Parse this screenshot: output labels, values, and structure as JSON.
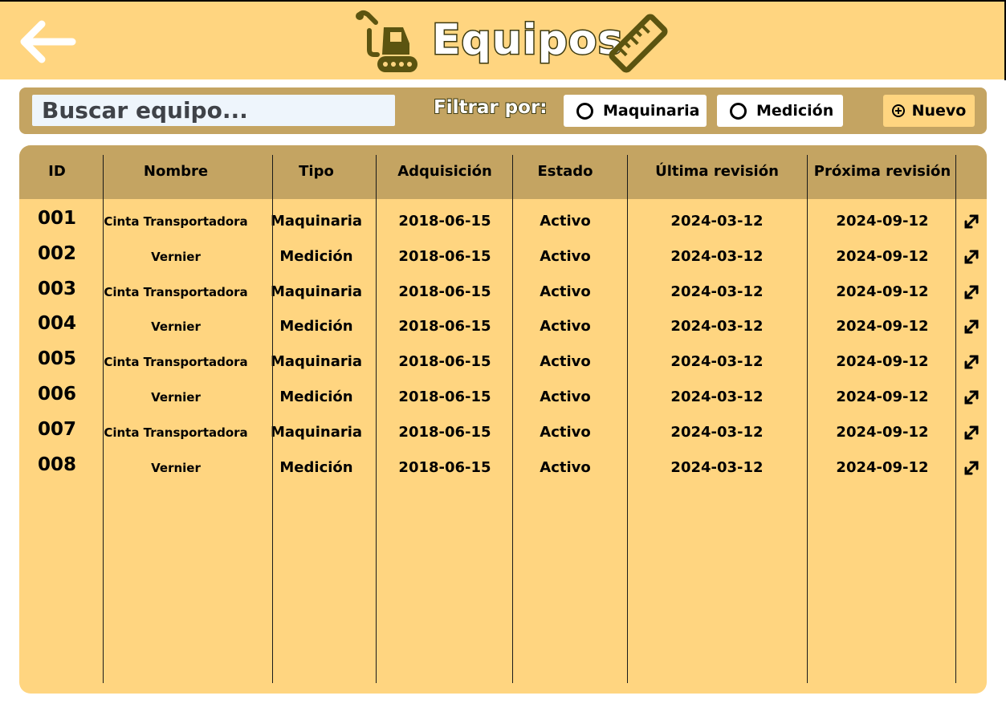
{
  "header": {
    "title": "Equipos",
    "back_icon": "arrow-left-icon",
    "left_icon": "excavator-icon",
    "right_icon": "ruler-icon"
  },
  "toolbar": {
    "search_placeholder": "Buscar equipo...",
    "filter_label": "Filtrar por:",
    "filters": [
      {
        "label": "Maquinaria",
        "selected": false
      },
      {
        "label": "Medición",
        "selected": false
      }
    ],
    "new_label": "Nuevo"
  },
  "table": {
    "columns": [
      "ID",
      "Nombre",
      "Tipo",
      "Adquisición",
      "Estado",
      "Última revisión",
      "Próxima revisión"
    ],
    "rows": [
      {
        "id": "001",
        "nombre": "Cinta Transportadora",
        "tipo": "Maquinaria",
        "adquisicion": "2018-06-15",
        "estado": "Activo",
        "ultima": "2024-03-12",
        "proxima": "2024-09-12"
      },
      {
        "id": "002",
        "nombre": "Vernier",
        "tipo": "Medición",
        "adquisicion": "2018-06-15",
        "estado": "Activo",
        "ultima": "2024-03-12",
        "proxima": "2024-09-12"
      },
      {
        "id": "003",
        "nombre": "Cinta Transportadora",
        "tipo": "Maquinaria",
        "adquisicion": "2018-06-15",
        "estado": "Activo",
        "ultima": "2024-03-12",
        "proxima": "2024-09-12"
      },
      {
        "id": "004",
        "nombre": "Vernier",
        "tipo": "Medición",
        "adquisicion": "2018-06-15",
        "estado": "Activo",
        "ultima": "2024-03-12",
        "proxima": "2024-09-12"
      },
      {
        "id": "005",
        "nombre": "Cinta Transportadora",
        "tipo": "Maquinaria",
        "adquisicion": "2018-06-15",
        "estado": "Activo",
        "ultima": "2024-03-12",
        "proxima": "2024-09-12"
      },
      {
        "id": "006",
        "nombre": "Vernier",
        "tipo": "Medición",
        "adquisicion": "2018-06-15",
        "estado": "Activo",
        "ultima": "2024-03-12",
        "proxima": "2024-09-12"
      },
      {
        "id": "007",
        "nombre": "Cinta Transportadora",
        "tipo": "Maquinaria",
        "adquisicion": "2018-06-15",
        "estado": "Activo",
        "ultima": "2024-03-12",
        "proxima": "2024-09-12"
      },
      {
        "id": "008",
        "nombre": "Vernier",
        "tipo": "Medición",
        "adquisicion": "2018-06-15",
        "estado": "Activo",
        "ultima": "2024-03-12",
        "proxima": "2024-09-12"
      }
    ],
    "row_action_icon": "expand-icon"
  },
  "colors": {
    "header_bg": "#ffd580",
    "toolbar_bg": "#c4a462",
    "table_bg": "#ffd580",
    "table_head_bg": "#c4a462",
    "icon_olive": "#5b5410"
  }
}
